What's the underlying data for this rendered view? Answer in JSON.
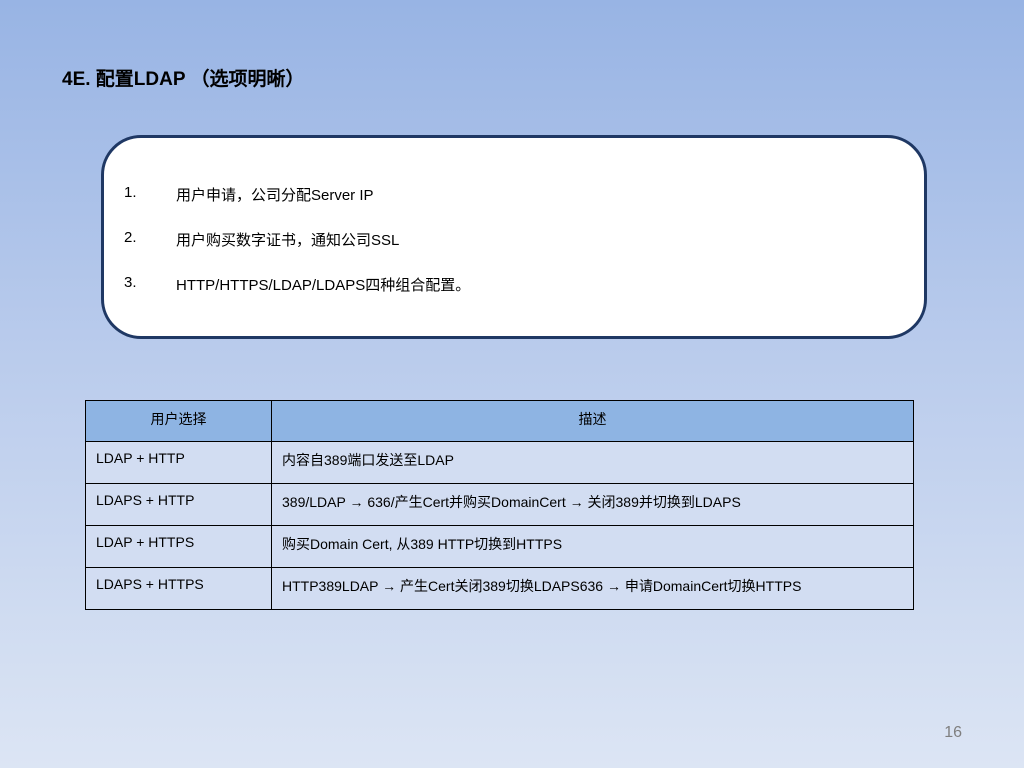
{
  "slide": {
    "title": "4E. 配置LDAP （选项明晰）",
    "page_number": "16"
  },
  "steps": [
    {
      "num": "1.",
      "text": "用户申请，公司分配Server IP"
    },
    {
      "num": "2.",
      "text": "用户购买数字证书，通知公司SSL"
    },
    {
      "num": "3.",
      "text": "HTTP/HTTPS/LDAP/LDAPS四种组合配置。"
    }
  ],
  "table": {
    "headers": [
      "用户选择",
      "描述"
    ],
    "rows": [
      {
        "choice": "LDAP + HTTP",
        "description": "内容自389端口发送至LDAP"
      },
      {
        "choice": "LDAPS + HTTP",
        "description": "389/LDAP → 636/产生Cert并购买DomainCert → 关闭389并切换到LDAPS"
      },
      {
        "choice": "LDAP + HTTPS",
        "description": "购买Domain Cert, 从389 HTTP切换到HTTPS"
      },
      {
        "choice": "LDAPS + HTTPS",
        "description": "HTTP389LDAP → 产生Cert关闭389切换LDAPS636 → 申请DomainCert切换HTTPS"
      }
    ]
  }
}
